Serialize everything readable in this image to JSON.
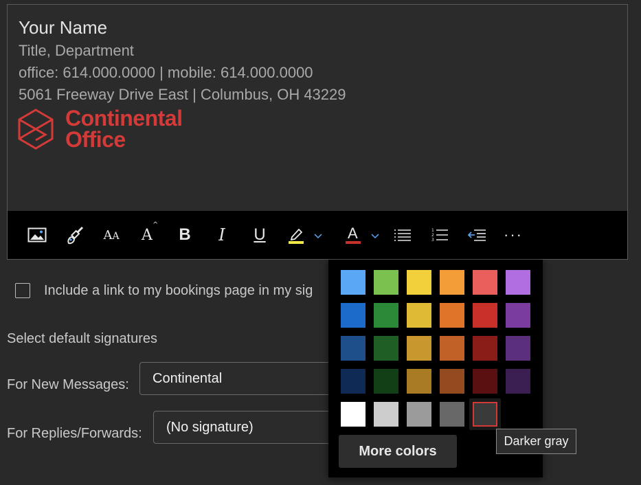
{
  "signature": {
    "name": "Your Name",
    "title": "Title, Department",
    "phones": "office: 614.000.0000 | mobile: 614.000.0000",
    "address": "5061 Freeway Drive East | Columbus, OH 43229",
    "logo_line1": "Continental",
    "logo_line2": "Office",
    "brand_color": "#d33a38"
  },
  "toolbar": {
    "buttons": [
      {
        "name": "insert-picture",
        "icon": "image-icon"
      },
      {
        "name": "format-painter",
        "icon": "paintbrush-icon"
      },
      {
        "name": "font-size",
        "icon": "font-size-icon",
        "label": "AA"
      },
      {
        "name": "change-case",
        "icon": "change-case-icon",
        "label": "A"
      },
      {
        "name": "bold",
        "icon": "bold-icon",
        "label": "B"
      },
      {
        "name": "italic",
        "icon": "italic-icon",
        "label": "I"
      },
      {
        "name": "underline",
        "icon": "underline-icon",
        "label": "U"
      },
      {
        "name": "highlight",
        "icon": "highlighter-icon"
      },
      {
        "name": "font-color",
        "icon": "font-color-icon",
        "label": "A"
      },
      {
        "name": "bullets",
        "icon": "bullet-list-icon"
      },
      {
        "name": "numbering",
        "icon": "numbered-list-icon"
      },
      {
        "name": "decrease-indent",
        "icon": "decrease-indent-icon"
      },
      {
        "name": "more-options",
        "icon": "more-icon"
      }
    ]
  },
  "bookings_checkbox_label": "Include a link to my bookings page in my sig",
  "defaults": {
    "section_title": "Select default signatures",
    "new_messages_label": "For New Messages:",
    "new_messages_value": "Continental",
    "replies_label": "For Replies/Forwards:",
    "replies_value": "(No signature)"
  },
  "color_picker": {
    "rows": [
      [
        "#5aa8f5",
        "#7bc150",
        "#f1d03c",
        "#f29d38",
        "#ea5f5b",
        "#b06ee0"
      ],
      [
        "#1c6ac9",
        "#2a8a38",
        "#dfbb35",
        "#e07429",
        "#c8302a",
        "#7a3c9e"
      ],
      [
        "#1f4f8a",
        "#1f5e25",
        "#c8982f",
        "#c16127",
        "#8b1d18",
        "#5c2f7d"
      ],
      [
        "#0e2a55",
        "#133f17",
        "#a97b24",
        "#944b1f",
        "#5a1010",
        "#3b1f52"
      ],
      [
        "#ffffff",
        "#cdcdcd",
        "#9b9b9b",
        "#686868",
        "#3a3a3a"
      ]
    ],
    "selected_color": "#3a3a3a",
    "selected_ring_color": "#d23a38",
    "more_colors_label": "More colors",
    "tooltip": "Darker gray"
  }
}
